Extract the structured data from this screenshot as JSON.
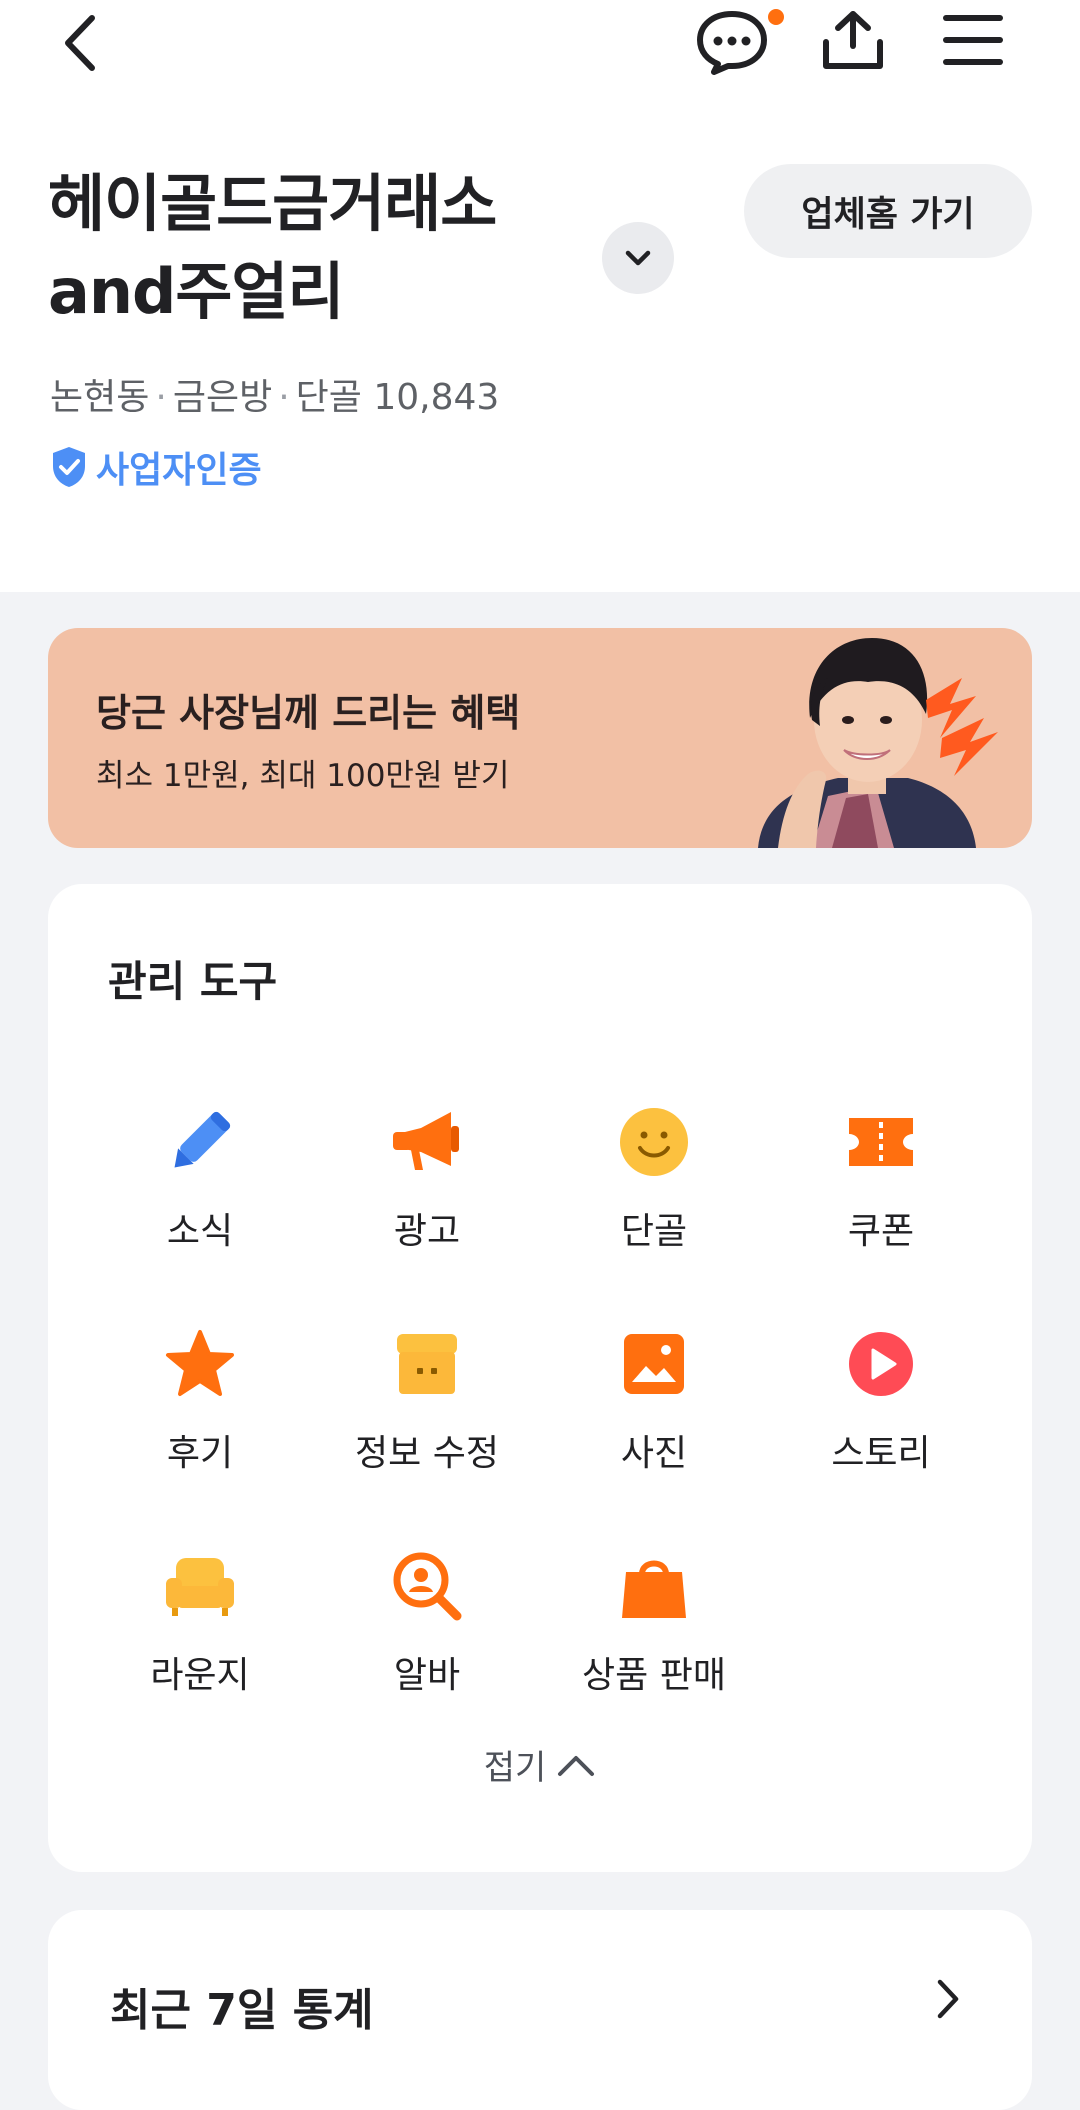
{
  "appbar": {
    "icons": [
      "back-arrow-icon",
      "chat-icon",
      "share-icon",
      "menu-icon"
    ],
    "notification_color": "#ff6f0f"
  },
  "store": {
    "name_line1": "헤이골드금거래소",
    "name_line2": "and주얼리",
    "home_button": "업체홈 가기",
    "neighborhood": "논현동",
    "category": "금은방",
    "regulars": "단골 10,843",
    "verified_label": "사업자인증",
    "verified_color": "#4d8ff5"
  },
  "banner": {
    "title": "당근 사장님께 드리는 혜택",
    "subtitle": "최소 1만원, 최대 100만원 받기",
    "background": "#f2c0a5"
  },
  "tools": {
    "title": "관리 도구",
    "items": [
      {
        "label": "소식",
        "icon": "pencil-icon",
        "color": "#4d8ff5"
      },
      {
        "label": "광고",
        "icon": "megaphone-icon",
        "color": "#ff6f0f"
      },
      {
        "label": "단골",
        "icon": "smile-icon",
        "color": "#fcc13f"
      },
      {
        "label": "쿠폰",
        "icon": "coupon-icon",
        "color": "#ff6f0f"
      },
      {
        "label": "후기",
        "icon": "star-icon",
        "color": "#ff6f0f"
      },
      {
        "label": "정보 수정",
        "icon": "store-icon",
        "color": "#fcb83a"
      },
      {
        "label": "사진",
        "icon": "photo-icon",
        "color": "#ff6f0f"
      },
      {
        "label": "스토리",
        "icon": "play-icon",
        "color": "#ff4b55"
      },
      {
        "label": "라운지",
        "icon": "sofa-icon",
        "color": "#fcb83a"
      },
      {
        "label": "알바",
        "icon": "job-search-icon",
        "color": "#ff6f0f"
      },
      {
        "label": "상품 판매",
        "icon": "shopping-bag-icon",
        "color": "#ff6f0f"
      }
    ],
    "collapse_label": "접기"
  },
  "stats": {
    "title": "최근 7일 통계"
  }
}
